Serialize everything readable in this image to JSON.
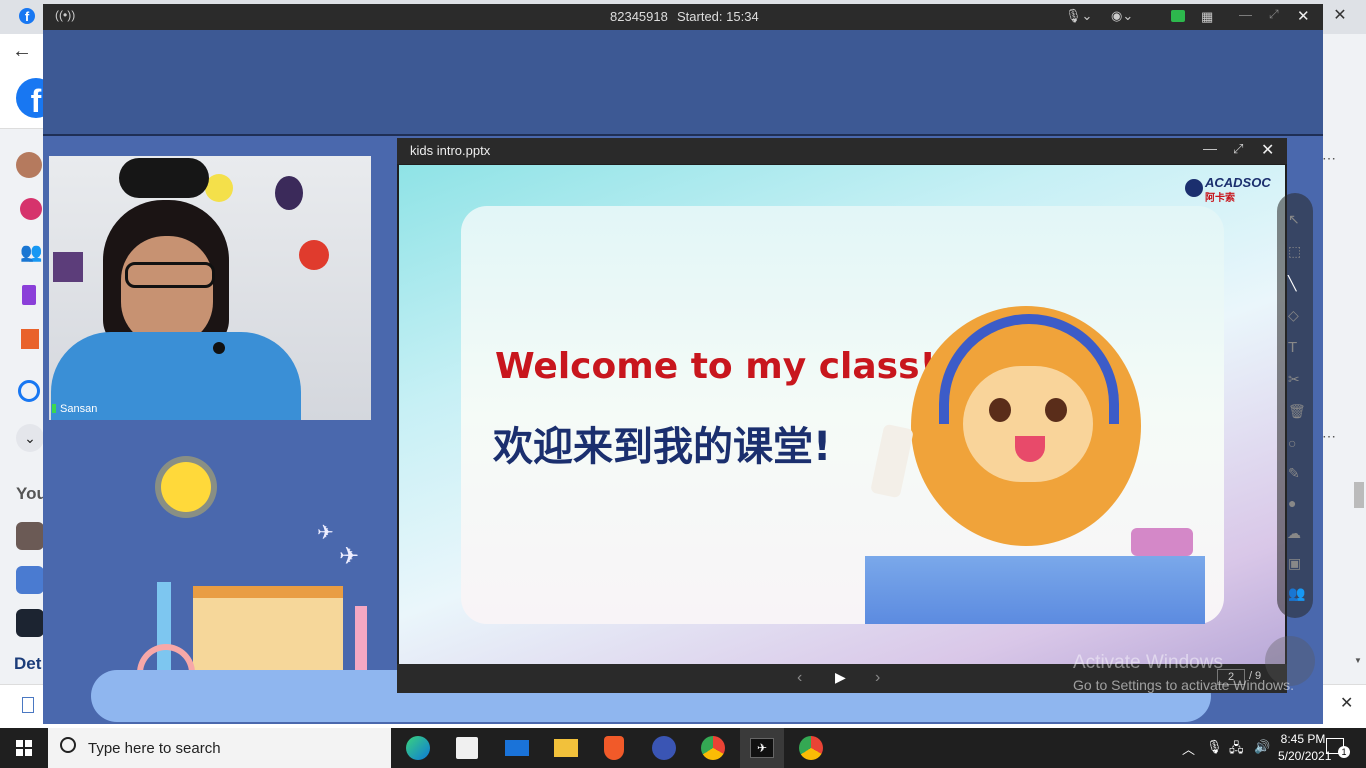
{
  "session": {
    "id": "82345918",
    "started": "Started: 15:34"
  },
  "video": {
    "participant_name": "Sansan"
  },
  "presentation": {
    "file_name": "kids intro.pptx",
    "brand_logo": "ACADSOC",
    "brand_logo_cn": "阿卡索",
    "heading_en": "Welcome to my class!",
    "heading_cn": "欢迎来到我的课堂!",
    "page_current": "2",
    "page_total": "9"
  },
  "facebook": {
    "section_label": "You",
    "side_label_partial": "Det"
  },
  "activation": {
    "title": "Activate Windows",
    "subtitle": "Go to Settings to activate Windows."
  },
  "taskbar": {
    "search_placeholder": "Type here to search",
    "time": "8:45 PM",
    "date": "5/20/2021",
    "notification_count": "1"
  },
  "colors": {
    "classroom_bg": "#3f5a9a",
    "heading_red": "#c8161d",
    "heading_navy": "#1b2f6e",
    "taskbar": "#1f1f1f"
  }
}
